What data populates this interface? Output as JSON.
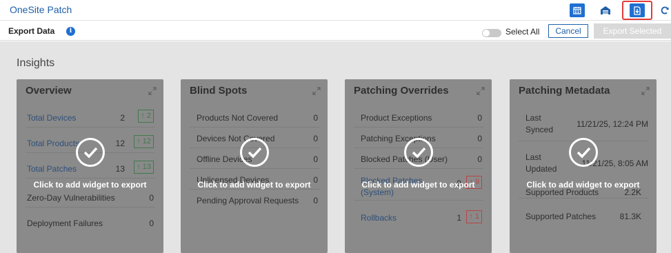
{
  "app": {
    "title": "OneSite Patch"
  },
  "toolbar": {
    "buttons": [
      {
        "icon": "calendar-icon",
        "active": true
      },
      {
        "icon": "garage-icon",
        "active": false
      },
      {
        "icon": "export-file-icon",
        "active": true
      },
      {
        "icon": "refresh-icon",
        "active": false
      }
    ]
  },
  "subbar": {
    "export_label": "Export Data",
    "select_all_label": "Select All",
    "cancel_label": "Cancel",
    "export_selected_label": "Export Selected"
  },
  "insights": {
    "title": "Insights"
  },
  "overlay_text": "Click to add widget to export",
  "cards": {
    "overview": {
      "title": "Overview",
      "rows": [
        {
          "label": "Total Devices",
          "value": "2",
          "badge": "↑ 2"
        },
        {
          "label": "Total Products",
          "value": "12",
          "badge": "↑ 12"
        },
        {
          "label": "Total Patches",
          "value": "13",
          "badge": "↑ 13"
        },
        {
          "label": "Zero-Day Vulnerabilities",
          "value": "0"
        },
        {
          "label": "Deployment Failures",
          "value": "0"
        }
      ]
    },
    "blind_spots": {
      "title": "Blind Spots",
      "rows": [
        {
          "label": "Products Not Covered",
          "value": "0"
        },
        {
          "label": "Devices Not Covered",
          "value": "0"
        },
        {
          "label": "Offline Devices",
          "value": "0"
        },
        {
          "label": "Unlicensed Devices",
          "value": "0"
        },
        {
          "label": "Pending Approval Requests",
          "value": "0"
        }
      ]
    },
    "patching_overrides": {
      "title": "Patching Overrides",
      "rows": [
        {
          "label": "Product Exceptions",
          "value": "0"
        },
        {
          "label": "Patching Exceptions",
          "value": "0"
        },
        {
          "label": "Blocked Patches (User)",
          "value": "0"
        },
        {
          "label": "Blocked Patches",
          "label2": "(System)",
          "value": "9",
          "badge": "↑ 9"
        },
        {
          "label": "Rollbacks",
          "value": "1",
          "badge": "↑ 1"
        }
      ]
    },
    "patching_metadata": {
      "title": "Patching Metadata",
      "rows": [
        {
          "label": "Last",
          "label2": "Synced",
          "value": "11/21/25, 12:24 PM"
        },
        {
          "label": "Last",
          "label2": "Updated",
          "value": "11/21/25, 8:05 AM"
        },
        {
          "label": "Supported Products",
          "value": "2.2K"
        },
        {
          "label": "Supported Patches",
          "value": "81.3K"
        }
      ]
    }
  },
  "colors": {
    "accent": "#1f6fd1",
    "highlight": "#e23b3b",
    "card_bg": "#8a8a8a",
    "page_bg": "#e4e4e4"
  }
}
